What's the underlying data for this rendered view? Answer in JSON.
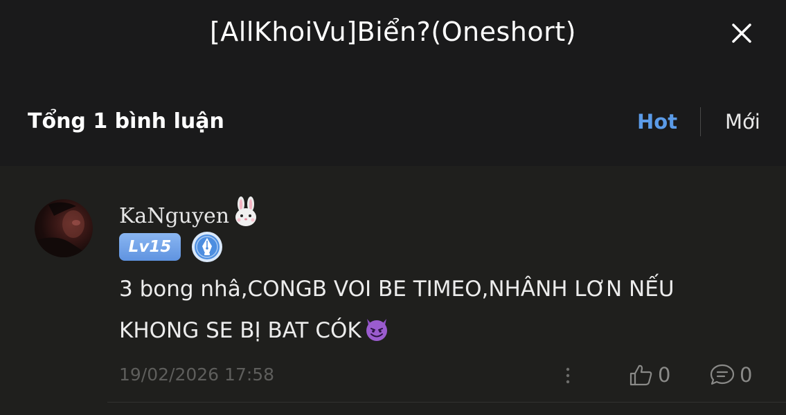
{
  "header": {
    "title": "[AllKhoiVu]Biển?(Oneshort)",
    "close_icon": "close-icon"
  },
  "subheader": {
    "total_label": "Tổng 1 bình luận",
    "sort_hot": "Hot",
    "sort_new": "Mới",
    "active_sort": "Hot",
    "accent_color": "#5b9be8"
  },
  "comments": [
    {
      "username": "KaNguyen",
      "username_emoji": "rabbit-emoji",
      "level": "Lv15",
      "badge_icon": "pen-nib-badge-icon",
      "text_line1": "3 bong nhâ,CONGB VOI BE TIMEO,NHÂNH LƠN NẾU",
      "text_line2": "KHONG SE BỊ BAT CÓK",
      "text_emoji": "smiling-devil-emoji",
      "timestamp": "19/02/2026 17:58",
      "likes": "0",
      "replies": "0"
    }
  ]
}
